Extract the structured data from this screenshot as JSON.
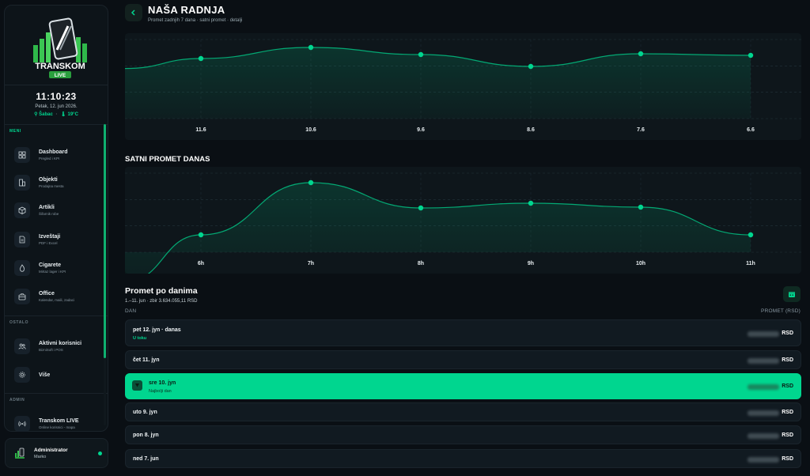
{
  "app": {
    "name": "TRANSKOM",
    "logo_sub": "LIVE"
  },
  "clock": {
    "time": "11:10:23",
    "date": "Petak, 12. jun 2026.",
    "city": "Šabac",
    "temperature": "19°C"
  },
  "sidebar": {
    "menu_label": "MENI",
    "menu_items": [
      {
        "title": "Dashboard",
        "sub": "Pregled i KPI",
        "icon": "grid-icon"
      },
      {
        "title": "Objekti",
        "sub": "Prodajna mesta",
        "icon": "building-icon"
      },
      {
        "title": "Artikli",
        "sub": "Šifarnik robe",
        "icon": "box-icon"
      },
      {
        "title": "Izveštaji",
        "sub": "PDF i Excel",
        "icon": "document-icon"
      },
      {
        "title": "Cigarete",
        "sub": "Mirtaz lager i KPI",
        "icon": "flame-icon"
      },
      {
        "title": "Office",
        "sub": "Kalendar, maili, zadaci",
        "icon": "briefcase-icon"
      }
    ],
    "other_label": "OSTALO",
    "other_items": [
      {
        "title": "Aktivni korisnici",
        "sub": "BizniSoft i POS",
        "icon": "users-icon"
      },
      {
        "title": "Više",
        "sub": "",
        "icon": "gear-icon"
      }
    ],
    "admin_label": "ADMIN",
    "admin_items": [
      {
        "title": "Transkom LIVE",
        "sub": "Online korisnici - mapa",
        "icon": "broadcast-icon"
      }
    ]
  },
  "user": {
    "role": "Administrator",
    "name": "Marko"
  },
  "page": {
    "title": "NAŠA RADNJA",
    "subtitle": "Promet zadnjih 7 dana · satni promet · detalji"
  },
  "colors": {
    "accent": "#00d68f",
    "bg": "#0a0f14",
    "card": "#0e161b"
  },
  "chart_data": [
    {
      "type": "area",
      "title": "",
      "categories": [
        "11.6",
        "10.6",
        "9.6",
        "8.6",
        "7.6",
        "6.6"
      ],
      "values": [
        76,
        90,
        81,
        66,
        82,
        80
      ],
      "ylim": [
        0,
        100
      ],
      "grid": true
    },
    {
      "type": "area",
      "title": "SATNI PROMET DANAS",
      "categories": [
        "6h",
        "7h",
        "8h",
        "9h",
        "10h",
        "11h"
      ],
      "values": [
        22,
        88,
        56,
        62,
        57,
        22
      ],
      "ylim": [
        0,
        100
      ],
      "grid": true
    }
  ],
  "daily": {
    "title": "Promet po danima",
    "subtitle": "1.–11. jun · zbir 3.634.055,11 RSD",
    "col_day": "DAN",
    "col_amount": "PROMET (RSD)",
    "currency": "RSD",
    "rows": [
      {
        "day": "pet 12. jyn · danas",
        "tag": "U toku"
      },
      {
        "day": "čet 11. jyn",
        "tag": ""
      },
      {
        "day": "sre 10. jyn",
        "tag": "Najbolji dan"
      },
      {
        "day": "uto 9. jyn",
        "tag": ""
      },
      {
        "day": "pon 8. jyn",
        "tag": ""
      },
      {
        "day": "ned 7. jun",
        "tag": ""
      }
    ]
  }
}
